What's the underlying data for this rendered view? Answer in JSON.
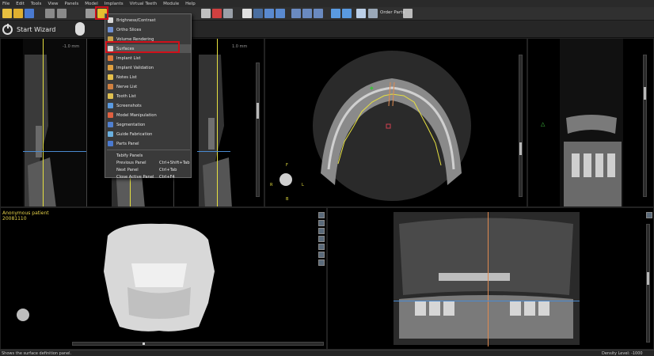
{
  "menubar": {
    "items": [
      "File",
      "Edit",
      "Tools",
      "View",
      "Panels",
      "Model",
      "Implants",
      "Virtual Teeth",
      "Module",
      "Help"
    ]
  },
  "toolbar": {
    "order_parts_label": "Order Parts"
  },
  "wizard": {
    "label": "Start Wizard"
  },
  "dropdown": {
    "items": [
      {
        "label": "Brighness/Contrast",
        "shortcut": "",
        "icon": "brightness-icon",
        "color": "#d9d9d9"
      },
      {
        "label": "Ortho Slices",
        "shortcut": "",
        "icon": "ortho-slices-icon",
        "color": "#6f8fd0"
      },
      {
        "label": "Volume Rendering",
        "shortcut": "",
        "icon": "volume-icon",
        "color": "#c8a24a"
      },
      {
        "label": "Surfaces",
        "shortcut": "",
        "icon": "surfaces-icon",
        "color": "#d6d6d6"
      },
      {
        "label": "Implant List",
        "shortcut": "",
        "icon": "implant-list-icon",
        "color": "#e07a3a"
      },
      {
        "label": "Implant Validation",
        "shortcut": "",
        "icon": "implant-validation-icon",
        "color": "#e0a040"
      },
      {
        "label": "Notes List",
        "shortcut": "",
        "icon": "notes-icon",
        "color": "#e6c04a"
      },
      {
        "label": "Nerve List",
        "shortcut": "",
        "icon": "nerve-icon",
        "color": "#d08040"
      },
      {
        "label": "Tooth List",
        "shortcut": "",
        "icon": "tooth-icon",
        "color": "#e0c050"
      },
      {
        "label": "Screenshots",
        "shortcut": "",
        "icon": "screenshots-icon",
        "color": "#5a9ae0"
      },
      {
        "label": "Model Manipulation",
        "shortcut": "",
        "icon": "model-icon",
        "color": "#e06040"
      },
      {
        "label": "Segmentation",
        "shortcut": "",
        "icon": "segmentation-icon",
        "color": "#5080d0"
      },
      {
        "label": "Guide Fabrication",
        "shortcut": "",
        "icon": "guide-icon",
        "color": "#6ab0e0"
      },
      {
        "label": "Parts Panel",
        "shortcut": "",
        "icon": "parts-icon",
        "color": "#4a7ad0"
      }
    ],
    "tab_items": [
      {
        "label": "Tabify Panels",
        "shortcut": ""
      },
      {
        "label": "Previous Panel",
        "shortcut": "Ctrl+Shift+Tab"
      },
      {
        "label": "Next Panel",
        "shortcut": "Ctrl+Tab"
      },
      {
        "label": "Close Active Panel",
        "shortcut": "Ctrl+F4"
      }
    ]
  },
  "panels": {
    "cross_left_mm": "-1.0 mm",
    "cross_right_mm": "1.0 mm",
    "patient_name": "Anonymous patient",
    "patient_date": "20081110",
    "orient_labels": {
      "f": "F",
      "r": "R",
      "l": "L",
      "b": "B"
    }
  },
  "status": {
    "message": "Shows the surface definition panel.",
    "density": "Density Level: -1000"
  },
  "colors": {
    "accent_red": "#d0101a",
    "yellow_line": "#e6e040",
    "blue_line": "#4a8ad0",
    "orange_line": "#e08a50",
    "green_marker": "#40c040"
  }
}
